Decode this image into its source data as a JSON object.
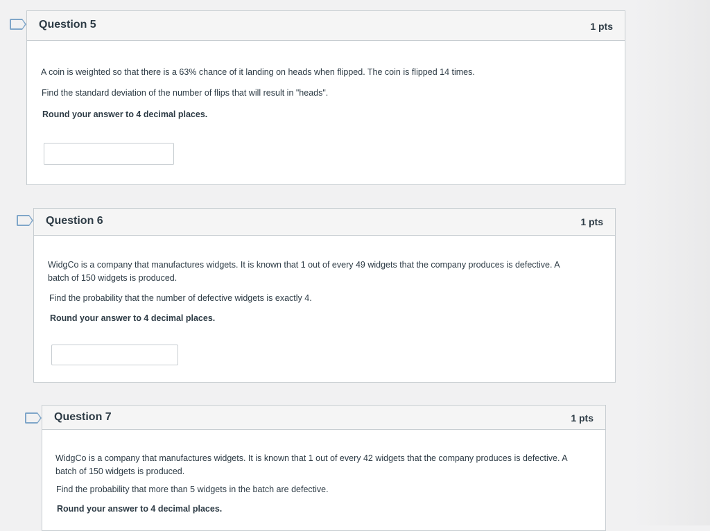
{
  "questions": [
    {
      "title": "Question 5",
      "points": "1 pts",
      "paragraphs": [
        "A coin is weighted so that there is a 63% chance of it landing on heads when flipped. The coin is flipped 14 times.",
        "Find the standard deviation of the number of flips that will result in \"heads\"."
      ],
      "instruction": "Round your answer to 4 decimal places.",
      "answer_value": ""
    },
    {
      "title": "Question 6",
      "points": "1 pts",
      "paragraphs": [
        "WidgCo is a company that manufactures widgets. It is known that 1 out of every 49 widgets that the company produces is defective. A batch of 150 widgets is produced.",
        "Find the probability that the number of defective widgets is exactly 4."
      ],
      "instruction": "Round your answer to 4 decimal places.",
      "answer_value": ""
    },
    {
      "title": "Question 7",
      "points": "1 pts",
      "paragraphs": [
        "WidgCo is a company that manufactures widgets. It is known that 1 out of every 42 widgets that the company produces is defective. A batch of 150 widgets is produced.",
        "Find the probability that more than 5 widgets in the batch are defective."
      ],
      "instruction": "Round your answer to 4 decimal places."
    }
  ],
  "colors": {
    "flag": "#7fa6c9",
    "header_bg": "#f5f5f5",
    "border": "#c7cdd1",
    "text": "#2d3b45"
  },
  "icons": {
    "flag": "flag-icon"
  }
}
